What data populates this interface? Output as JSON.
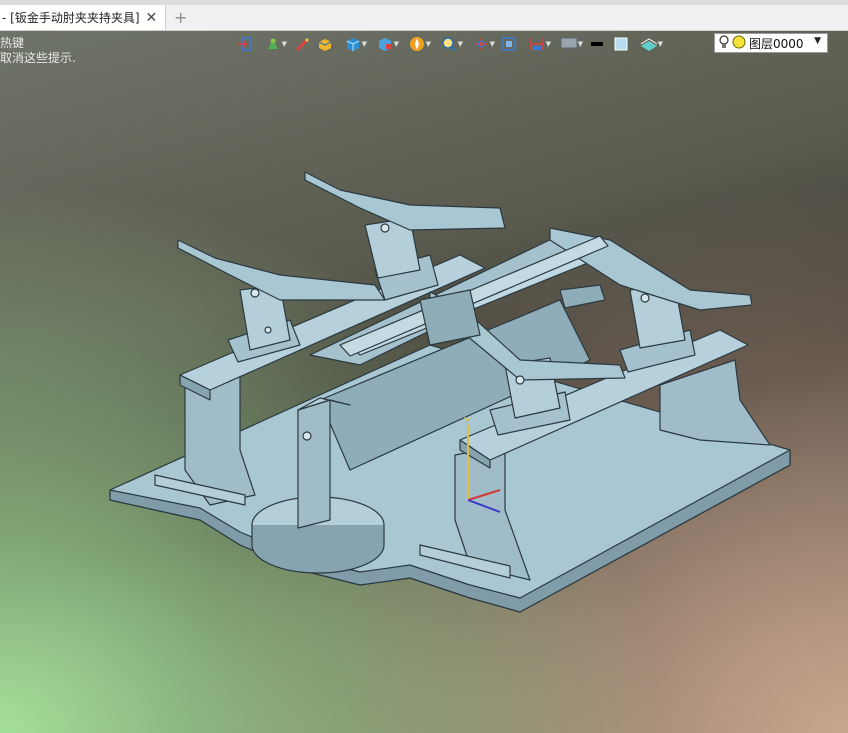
{
  "tab": {
    "title": "- [钣金手动肘夹夹持夹具]",
    "close_icon": "✕",
    "add_icon": "+"
  },
  "hint": {
    "line1": "热键",
    "line2": "取消这些提示."
  },
  "toolbar": {
    "icons": [
      "import-icon",
      "part-icon",
      "pen-icon",
      "box-icon",
      "cube-icon",
      "solid-icon",
      "compass-icon",
      "zoom-icon",
      "axis-icon",
      "frame-icon",
      "dimension-icon",
      "monitor-icon",
      "line-color-icon",
      "fill-color-icon",
      "material-icon"
    ]
  },
  "layer": {
    "value": "图层0000",
    "bulb_icon": "bulb-icon",
    "dot_color": "#f2e23a"
  },
  "colors": {
    "model_fill": "#a9c6d3",
    "model_stroke": "#2b3a40",
    "axis_x": "#d23a3a",
    "axis_y": "#e0c040",
    "axis_z": "#3a3ac8"
  }
}
